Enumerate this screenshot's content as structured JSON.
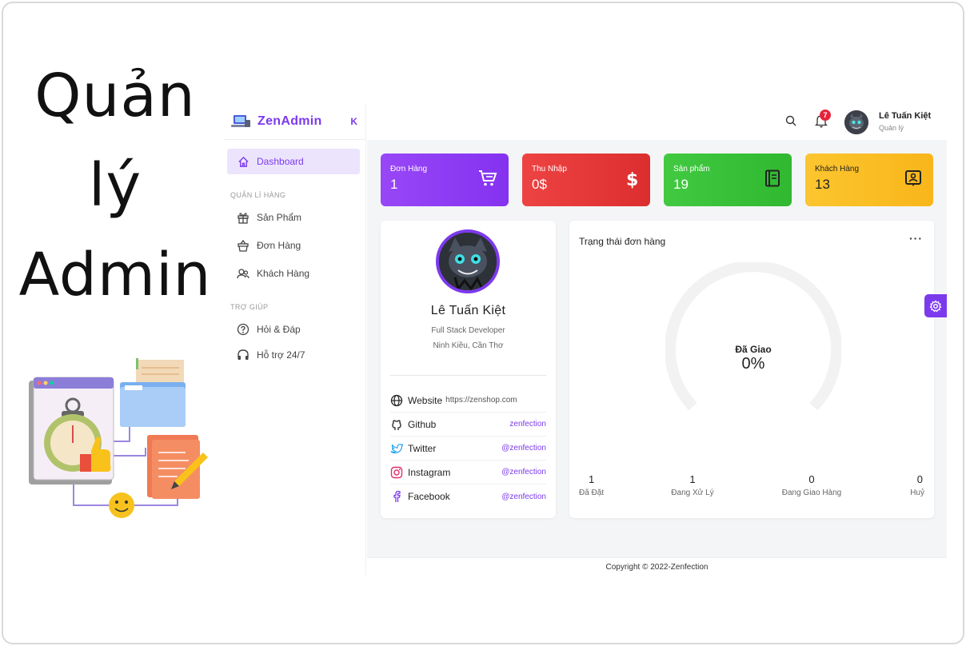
{
  "banner": {
    "title_lines": [
      "Quản",
      "lý",
      "Admin"
    ]
  },
  "brand": {
    "name": "ZenAdmin",
    "accent": "#7c3aed"
  },
  "sidebar": {
    "collapse_symbol": "K",
    "items": [
      {
        "label": "Dashboard",
        "icon": "home-icon",
        "active": true
      }
    ],
    "sections": [
      {
        "title": "QUẢN LÍ HÀNG",
        "items": [
          {
            "label": "Sản Phẩm",
            "icon": "gift-icon"
          },
          {
            "label": "Đơn Hàng",
            "icon": "basket-icon"
          },
          {
            "label": "Khách Hàng",
            "icon": "users-icon"
          }
        ]
      },
      {
        "title": "TRỢ GIÚP",
        "items": [
          {
            "label": "Hỏi & Đáp",
            "icon": "question-icon"
          },
          {
            "label": "Hỗ trợ 24/7",
            "icon": "headphones-icon"
          }
        ]
      }
    ]
  },
  "topbar": {
    "notification_count": "7",
    "user_name": "Lê Tuấn Kiệt",
    "user_role": "Quản lý"
  },
  "stats": [
    {
      "label": "Đơn Hàng",
      "value": "1",
      "color": "#8b3cf7",
      "icon": "cart-icon"
    },
    {
      "label": "Thu Nhập",
      "value": "0$",
      "color": "#e53939",
      "icon": "dollar-icon"
    },
    {
      "label": "Sản phẩm",
      "value": "19",
      "color": "#3ac43a",
      "icon": "notebook-icon"
    },
    {
      "label": "Khách Hàng",
      "value": "13",
      "color": "#fbbf24",
      "icon": "contact-icon"
    }
  ],
  "profile": {
    "name": "Lê Tuấn Kiệt",
    "job": "Full Stack Developer",
    "location": "Ninh Kiều, Cần Thơ",
    "links": [
      {
        "name": "Website",
        "value": "https://zenshop.com",
        "icon": "globe-icon"
      },
      {
        "name": "Github",
        "value": "zenfection",
        "icon": "github-icon"
      },
      {
        "name": "Twitter",
        "value": "@zenfection",
        "icon": "twitter-icon"
      },
      {
        "name": "Instagram",
        "value": "@zenfection",
        "icon": "instagram-icon"
      },
      {
        "name": "Facebook",
        "value": "@zenfection",
        "icon": "facebook-icon"
      }
    ]
  },
  "order_status": {
    "title": "Trạng thái đơn hàng",
    "more": "···",
    "gauge_label": "Đã Giao",
    "gauge_value": "0%",
    "gauge_fraction": 0,
    "counts": [
      {
        "value": "1",
        "label": "Đã Đặt"
      },
      {
        "value": "1",
        "label": "Đang Xử Lý"
      },
      {
        "value": "0",
        "label": "Đang Giao Hàng"
      },
      {
        "value": "0",
        "label": "Huỷ"
      }
    ]
  },
  "footer": {
    "copyright": "Copyright © 2022-Zenfection"
  }
}
